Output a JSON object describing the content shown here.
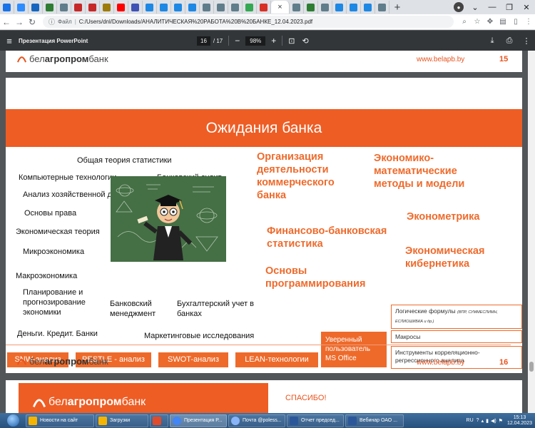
{
  "browser": {
    "tabs": [
      {
        "icon": "mail-icon",
        "color": "#1a73e8"
      },
      {
        "icon": "zoom-icon",
        "color": "#2d8cff"
      },
      {
        "icon": "swirl-icon",
        "color": "#1565c0"
      },
      {
        "icon": "chat-icon",
        "color": "#2e7d32"
      },
      {
        "icon": "globe-icon",
        "color": "#607d8b"
      },
      {
        "icon": "flag-icon",
        "color": "#c62828"
      },
      {
        "icon": "flag-icon",
        "color": "#c62828"
      },
      {
        "icon": "emblem-icon",
        "color": "#9e7c0a"
      },
      {
        "icon": "youtube-icon",
        "color": "#ff0000"
      },
      {
        "icon": "doc-icon",
        "color": "#3f51b5"
      },
      {
        "icon": "book-icon",
        "color": "#1e88e5"
      },
      {
        "icon": "book-icon",
        "color": "#1e88e5"
      },
      {
        "icon": "book-icon",
        "color": "#1e88e5"
      },
      {
        "icon": "book-icon",
        "color": "#1e88e5"
      },
      {
        "icon": "globe-icon",
        "color": "#607d8b"
      },
      {
        "icon": "globe-icon",
        "color": "#607d8b"
      },
      {
        "icon": "globe-icon",
        "color": "#607d8b"
      },
      {
        "icon": "drive-icon",
        "color": "#34a853"
      },
      {
        "icon": "pdf-icon",
        "color": "#d93025"
      }
    ],
    "tabs_after": [
      {
        "icon": "globe-icon",
        "color": "#607d8b"
      },
      {
        "icon": "teams-icon",
        "color": "#2e7d32"
      },
      {
        "icon": "globe-icon",
        "color": "#607d8b"
      },
      {
        "icon": "vpn-icon",
        "color": "#1e88e5"
      },
      {
        "icon": "vpn-icon",
        "color": "#1e88e5"
      },
      {
        "icon": "vpn-icon",
        "color": "#1e88e5"
      },
      {
        "icon": "globe-icon",
        "color": "#607d8b"
      }
    ],
    "active_tab_close": "×",
    "new_tab": "+",
    "url_scheme": "Файл",
    "url": "C:/Users/dnl/Downloads/АНАЛИТИЧЕСКАЯ%20РАБОТА%20В%20БАНКЕ_12.04.2023.pdf"
  },
  "pdf": {
    "title": "Презентация PowerPoint",
    "page_current": "16",
    "page_total": "/ 17",
    "zoom": "98%",
    "zoom_out": "−",
    "zoom_in": "+"
  },
  "slide_prev": {
    "logo_pre": "бел",
    "logo_mid": "агропром",
    "logo_post": "банк",
    "site": "www.belapb.by",
    "page": "15"
  },
  "slide": {
    "banner": "Ожидания банка",
    "left_items": [
      "Общая теория статистики",
      "Компьютерные технологии",
      "Банковский аудит",
      "Анализ хозяйственной деятельности",
      "Основы права",
      "Экономическая теория",
      "Микроэкономика",
      "Макроэкономика",
      "Планирование и прогнозирование экономики",
      "Банковский менеджмент",
      "Бухгалтерский учет в банках",
      "Деньги. Кредит. Банки",
      "Маркетинговые исследования"
    ],
    "orange_items": [
      "Организация деятельности коммерческого банка",
      "Экономико-математические методы и модели",
      "Эконометрика",
      "Финансово-банковская статистика",
      "Экономическая кибернетика",
      "Основы программирования"
    ],
    "chips": [
      "SNW-анализ",
      "PESTLE - анализ",
      "SWOT-анализ",
      "LEAN-технологии"
    ],
    "office_box": "Уверенный пользователь MS Office",
    "outline_boxes": {
      "formulas": "Логические формулы",
      "formulas_note": "(ВПР, СУММЕСЛИМН, ЕСЛИОШИБКА и др.)",
      "macros": "Макросы",
      "tools": "Инструменты корреляционно-регрессионного анализа"
    },
    "site": "www.belapb.by",
    "page": "16"
  },
  "slide_next": {
    "thanks": "СПАСИБО!"
  },
  "taskbar": {
    "apps": [
      {
        "label": "Новости на сайт",
        "color": "#f5b400"
      },
      {
        "label": "Загрузки",
        "color": "#f5b400"
      },
      {
        "label": "",
        "color": "#e04b2b"
      },
      {
        "label": "Презентация Р...",
        "color": "#4285f4"
      },
      {
        "label": "Почта @poless...",
        "color": "#8ab4f8"
      },
      {
        "label": "Отчет председ...",
        "color": "#2b579a"
      },
      {
        "label": "Вебинар ОАО ...",
        "color": "#2b579a"
      }
    ],
    "lang": "RU",
    "time": "15:13",
    "date": "12.04.2023"
  }
}
